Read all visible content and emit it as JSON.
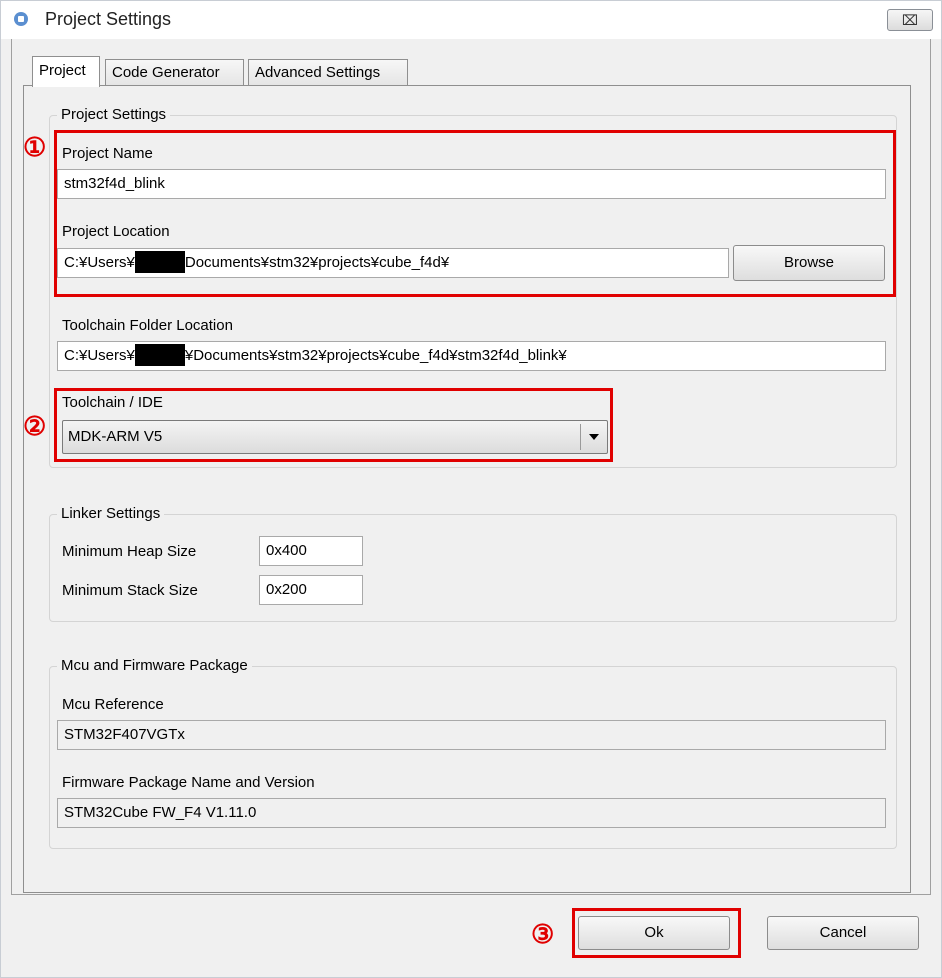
{
  "window": {
    "title": "Project Settings",
    "close_label": "⌧"
  },
  "tabs": [
    {
      "label": "Project",
      "active": true
    },
    {
      "label": "Code Generator",
      "active": false
    },
    {
      "label": "Advanced Settings",
      "active": false
    }
  ],
  "project_settings": {
    "legend": "Project Settings",
    "project_name_label": "Project Name",
    "project_name_value": "stm32f4d_blink",
    "project_location_label": "Project Location",
    "project_location_prefix": "C:¥Users¥",
    "project_location_suffix": "Documents¥stm32¥projects¥cube_f4d¥",
    "browse_label": "Browse",
    "toolchain_folder_label": "Toolchain Folder Location",
    "toolchain_folder_prefix": "C:¥Users¥",
    "toolchain_folder_suffix": "¥Documents¥stm32¥projects¥cube_f4d¥stm32f4d_blink¥",
    "toolchain_ide_label": "Toolchain / IDE",
    "toolchain_ide_selected": "MDK-ARM V5"
  },
  "linker_settings": {
    "legend": "Linker Settings",
    "min_heap_label": "Minimum Heap Size",
    "min_heap_value": "0x400",
    "min_stack_label": "Minimum Stack Size",
    "min_stack_value": "0x200"
  },
  "mcu_firmware": {
    "legend": "Mcu and Firmware Package",
    "mcu_reference_label": "Mcu Reference",
    "mcu_reference_value": "STM32F407VGTx",
    "firmware_label": "Firmware Package Name and Version",
    "firmware_value": "STM32Cube FW_F4 V1.11.0"
  },
  "buttons": {
    "ok_label": "Ok",
    "cancel_label": "Cancel"
  },
  "annotations": {
    "marker_1": "①",
    "marker_2": "②",
    "marker_3": "③",
    "highlight_color": "#e00000"
  }
}
